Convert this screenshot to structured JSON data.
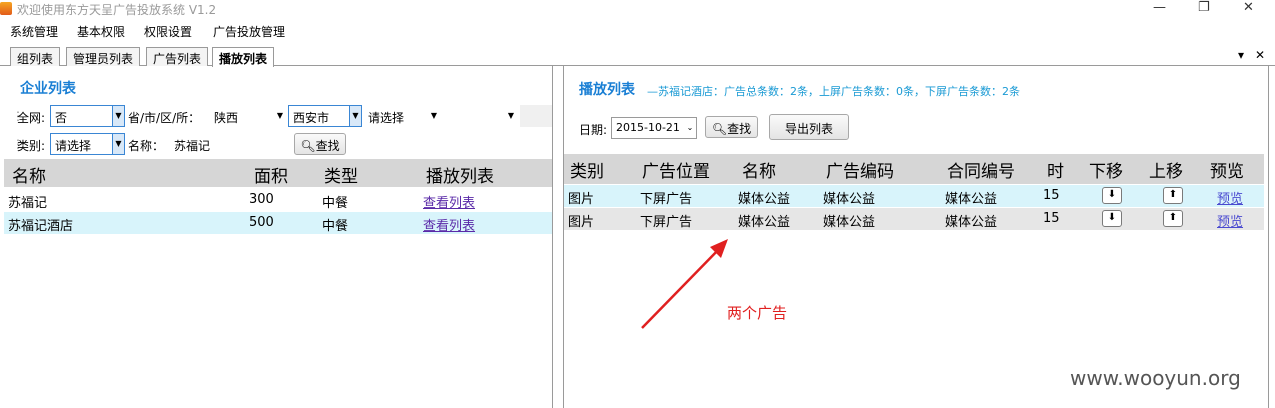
{
  "window": {
    "title": "欢迎使用东方天呈广告投放系统 V1.2",
    "min": "—",
    "max": "❐",
    "close": "✕"
  },
  "menu": [
    "系统管理",
    "基本权限",
    "权限设置",
    "广告投放管理"
  ],
  "tabs": [
    "组列表",
    "管理员列表",
    "广告列表",
    "播放列表"
  ],
  "tabbar": {
    "dropdown": "▾",
    "close": "✕"
  },
  "left": {
    "title": "企业列表",
    "filter": {
      "all_label": "全网:",
      "all_value": "否",
      "region_label": "省/市/区/所：",
      "province": "陕西",
      "city": "西安市",
      "district": "请选择",
      "extra": "",
      "type_label": "类别:",
      "type_value": "请选择",
      "name_label": "名称：",
      "name_value": "苏福记",
      "search_button": "查找"
    },
    "columns": [
      "名称",
      "面积",
      "类型",
      "播放列表"
    ],
    "rows": [
      {
        "name": "苏福记",
        "area": "300",
        "type": "中餐",
        "link": "查看列表"
      },
      {
        "name": "苏福记酒店",
        "area": "500",
        "type": "中餐",
        "link": "查看列表"
      }
    ]
  },
  "right": {
    "title": "播放列表",
    "summary": "—苏福记酒店：广告总条数：2条，上屏广告条数：0条，下屏广告条数：2条",
    "date_label": "日期:",
    "date_value": "2015-10-21",
    "search_button": "查找",
    "export_button": "导出列表",
    "columns": [
      "类别",
      "广告位置",
      "名称",
      "广告编码",
      "合同编号",
      "时",
      "下移",
      "上移",
      "预览"
    ],
    "rows": [
      {
        "category": "图片",
        "position": "下屏广告",
        "name": "媒体公益",
        "code": "媒体公益",
        "contract": "媒体公益",
        "duration": "15",
        "preview": "预览"
      },
      {
        "category": "图片",
        "position": "下屏广告",
        "name": "媒体公益",
        "code": "媒体公益",
        "contract": "媒体公益",
        "duration": "15",
        "preview": "预览"
      }
    ]
  },
  "annotation": "两个广告",
  "watermark": "www.wooyun.org",
  "colors": {
    "accent": "#1a7fd4",
    "row_highlight": "#d8f4fb",
    "annotation": "#e02020"
  }
}
